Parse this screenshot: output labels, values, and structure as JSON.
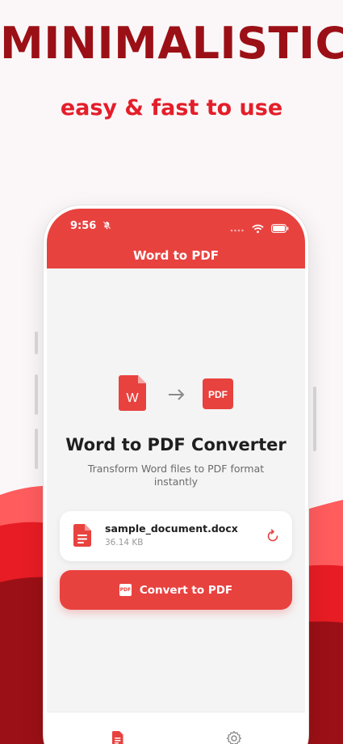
{
  "marketing": {
    "headline": "MINIMALISTIC",
    "tagline": "easy & fast to use"
  },
  "colors": {
    "brand_red": "#e8423f",
    "headline_dark_red": "#9b1016",
    "tagline_red": "#e41e2a",
    "wave_light": "#ff5c5e",
    "wave_mid": "#e81c24",
    "wave_dark": "#9b1016"
  },
  "status_bar": {
    "time": "9:56",
    "silent_icon": "bell-slash-icon",
    "signal_icon": "signal-dots-icon",
    "wifi_icon": "wifi-icon",
    "battery_icon": "battery-icon"
  },
  "app": {
    "title": "Word to PDF"
  },
  "hero": {
    "source_icon_letter": "W",
    "arrow_icon": "arrow-right-icon",
    "target_icon_text": "PDF",
    "title": "Word to PDF Converter",
    "subtitle": "Transform Word files to PDF format instantly"
  },
  "file": {
    "name": "sample_document.docx",
    "size": "36.14 KB",
    "icon": "document-icon",
    "action_icon": "refresh-icon"
  },
  "convert_button": {
    "label": "Convert to PDF",
    "icon_text": "PDF"
  },
  "tabs": [
    {
      "icon": "document-icon",
      "active": true
    },
    {
      "icon": "gear-icon",
      "active": false
    }
  ]
}
